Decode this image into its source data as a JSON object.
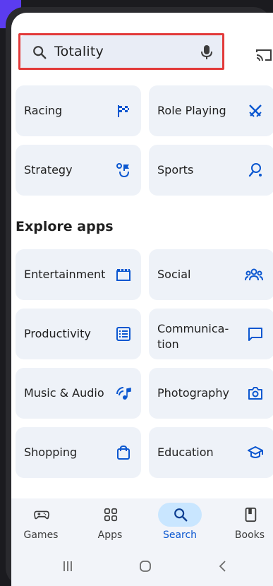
{
  "search": {
    "value": "Totality"
  },
  "games_tiles": [
    {
      "label": "Racing",
      "icon": "racing-flag-icon"
    },
    {
      "label": "Role Playing",
      "icon": "swords-icon"
    },
    {
      "label": "Strategy",
      "icon": "strategy-icon"
    },
    {
      "label": "Sports",
      "icon": "sports-icon"
    }
  ],
  "explore": {
    "title": "Explore apps",
    "tiles": [
      {
        "label": "Entertainment",
        "icon": "clapperboard-icon"
      },
      {
        "label": "Social",
        "icon": "people-icon"
      },
      {
        "label": "Productivity",
        "icon": "checklist-icon"
      },
      {
        "label": "Communica-\ntion",
        "icon": "chat-bubble-icon"
      },
      {
        "label": "Music & Audio",
        "icon": "music-note-icon"
      },
      {
        "label": "Photography",
        "icon": "camera-icon"
      },
      {
        "label": "Shopping",
        "icon": "shopping-bag-icon"
      },
      {
        "label": "Education",
        "icon": "graduation-cap-icon"
      }
    ]
  },
  "bottom_nav": [
    {
      "label": "Games",
      "icon": "gamepad-icon"
    },
    {
      "label": "Apps",
      "icon": "apps-grid-icon"
    },
    {
      "label": "Search",
      "icon": "search-icon",
      "active": true
    },
    {
      "label": "Books",
      "icon": "book-icon"
    }
  ],
  "colors": {
    "accent_blue": "#0b57d0",
    "tile_bg": "#eef2f8",
    "highlight_red": "#e23a3a"
  }
}
